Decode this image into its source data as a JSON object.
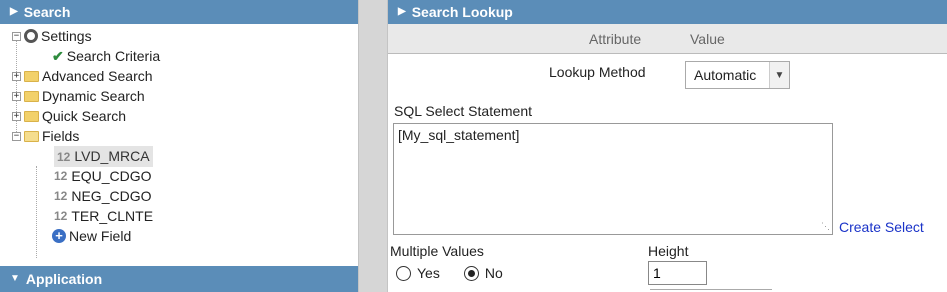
{
  "left": {
    "search_header": "Search",
    "tree": {
      "settings": "Settings",
      "search_criteria": "Search Criteria",
      "advanced_search": "Advanced Search",
      "dynamic_search": "Dynamic Search",
      "quick_search": "Quick Search",
      "fields": "Fields",
      "field_items": [
        {
          "num": "12",
          "label": "LVD_MRCA"
        },
        {
          "num": "12",
          "label": "EQU_CDGO"
        },
        {
          "num": "12",
          "label": "NEG_CDGO"
        },
        {
          "num": "12",
          "label": "TER_CLNTE"
        }
      ],
      "new_field": "New Field"
    },
    "application_header": "Application"
  },
  "right": {
    "header": "Search Lookup",
    "col_attribute": "Attribute",
    "col_value": "Value",
    "lookup_method_label": "Lookup Method",
    "lookup_method_value": "Automatic",
    "sql_label": "SQL Select Statement",
    "sql_value": "[My_sql_statement]",
    "create_select": "Create Select",
    "multiple_values_label": "Multiple Values",
    "yes_label": "Yes",
    "no_label": "No",
    "multiple_values_selected": "No",
    "height_label": "Height",
    "height_value": "1"
  },
  "colors": {
    "header_bg": "#5b8db8",
    "link": "#1a33c8",
    "check": "#2e8b3d"
  }
}
